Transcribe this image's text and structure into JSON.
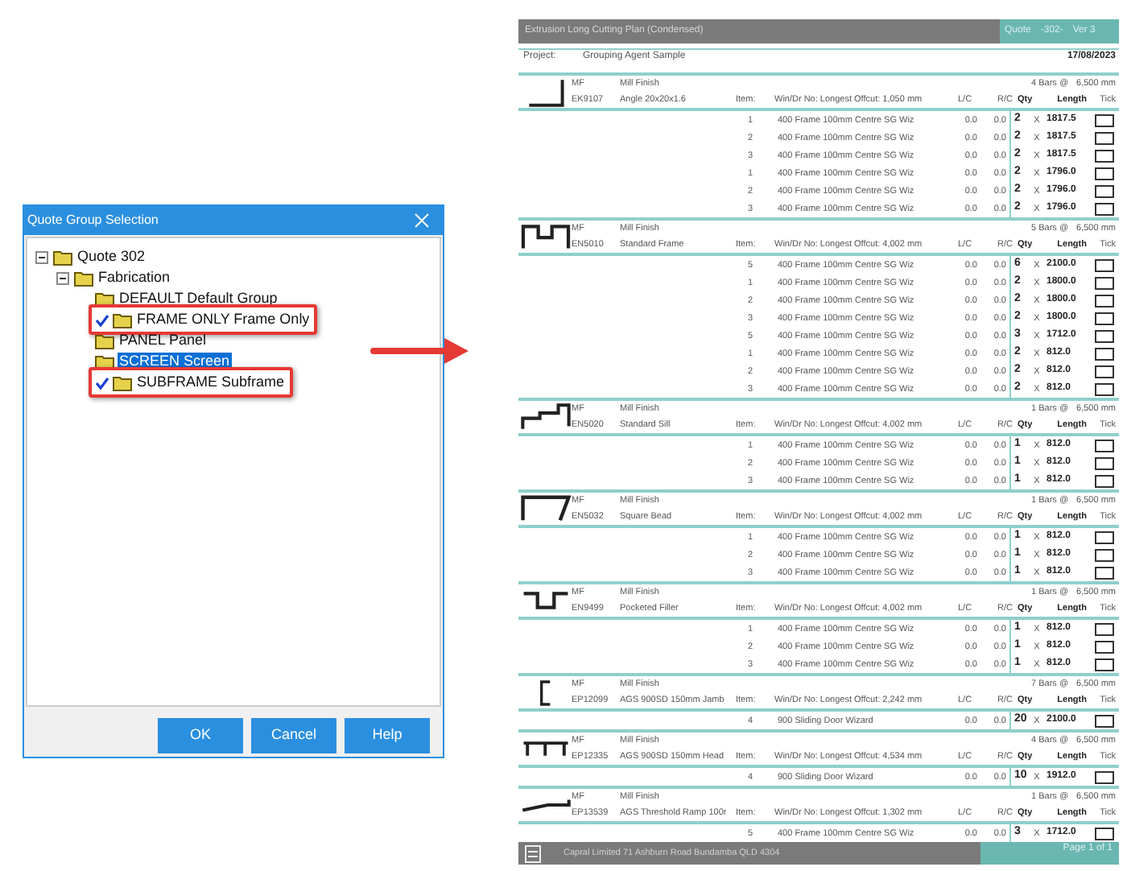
{
  "dialog": {
    "title": "Quote Group Selection",
    "tree": [
      {
        "label": "Quote  302",
        "expanded": true,
        "checked": false,
        "selected": false,
        "highlighted": false,
        "children": [
          {
            "label": "Fabrication",
            "expanded": true,
            "checked": false,
            "selected": false,
            "highlighted": false,
            "children": [
              {
                "label": "DEFAULT Default Group",
                "checked": false,
                "selected": false,
                "highlighted": false
              },
              {
                "label": "FRAME ONLY Frame Only",
                "checked": true,
                "selected": false,
                "highlighted": true
              },
              {
                "label": "PANEL Panel",
                "checked": false,
                "selected": false,
                "highlighted": false
              },
              {
                "label": "SCREEN Screen",
                "checked": false,
                "selected": true,
                "highlighted": false
              },
              {
                "label": "SUBFRAME Subframe",
                "checked": true,
                "selected": false,
                "highlighted": true
              }
            ]
          }
        ]
      }
    ],
    "buttons": [
      "OK",
      "Cancel",
      "Help"
    ]
  },
  "report": {
    "title": "Extrusion Long Cutting Plan (Condensed)",
    "quote_label": "Quote",
    "quote_number": "-302-",
    "version": "Ver 3",
    "project_label": "Project:",
    "project": "Grouping Agent Sample",
    "date": "17/08/2023",
    "sections": [
      {
        "kind": "angle",
        "finish_code": "MF",
        "finish": "Mill Finish",
        "code": "EK9107",
        "description": "Angle 20x20x1.6",
        "bars": "4 Bars @",
        "bar_length": "6,500 mm",
        "offcut": "Win/Dr No:  Longest Offcut: 1,050 mm",
        "labels": {
          "item": "Item:",
          "lc": "L/C",
          "rc": "R/C",
          "qty": "Qty",
          "length": "Length",
          "tick": "Tick"
        },
        "rows": [
          {
            "item": "1",
            "description": "400 Frame 100mm Centre SG Wiz",
            "lc": "0.0",
            "rc": "0.0",
            "qty": "2",
            "x": "X",
            "length": "1817.5",
            "ticked": false
          },
          {
            "item": "2",
            "description": "400 Frame 100mm Centre SG Wiz",
            "lc": "0.0",
            "rc": "0.0",
            "qty": "2",
            "x": "X",
            "length": "1817.5",
            "ticked": false
          },
          {
            "item": "3",
            "description": "400 Frame 100mm Centre SG Wiz",
            "lc": "0.0",
            "rc": "0.0",
            "qty": "2",
            "x": "X",
            "length": "1817.5",
            "ticked": false
          },
          {
            "item": "1",
            "description": "400 Frame 100mm Centre SG Wiz",
            "lc": "0.0",
            "rc": "0.0",
            "qty": "2",
            "x": "X",
            "length": "1796.0",
            "ticked": false
          },
          {
            "item": "2",
            "description": "400 Frame 100mm Centre SG Wiz",
            "lc": "0.0",
            "rc": "0.0",
            "qty": "2",
            "x": "X",
            "length": "1796.0",
            "ticked": false
          },
          {
            "item": "3",
            "description": "400 Frame 100mm Centre SG Wiz",
            "lc": "0.0",
            "rc": "0.0",
            "qty": "2",
            "x": "X",
            "length": "1796.0",
            "ticked": false
          }
        ]
      },
      {
        "kind": "frame",
        "finish_code": "MF",
        "finish": "Mill Finish",
        "code": "EN5010",
        "description": "Standard Frame",
        "bars": "5 Bars @",
        "bar_length": "6,500 mm",
        "offcut": "Win/Dr No:  Longest Offcut: 4,002 mm",
        "labels": {
          "item": "Item:",
          "lc": "L/C",
          "rc": "R/C",
          "qty": "Qty",
          "length": "Length",
          "tick": "Tick"
        },
        "rows": [
          {
            "item": "5",
            "description": "400 Frame 100mm Centre SG Wiz",
            "lc": "0.0",
            "rc": "0.0",
            "qty": "6",
            "x": "X",
            "length": "2100.0",
            "ticked": false
          },
          {
            "item": "1",
            "description": "400 Frame 100mm Centre SG Wiz",
            "lc": "0.0",
            "rc": "0.0",
            "qty": "2",
            "x": "X",
            "length": "1800.0",
            "ticked": false
          },
          {
            "item": "2",
            "description": "400 Frame 100mm Centre SG Wiz",
            "lc": "0.0",
            "rc": "0.0",
            "qty": "2",
            "x": "X",
            "length": "1800.0",
            "ticked": false
          },
          {
            "item": "3",
            "description": "400 Frame 100mm Centre SG Wiz",
            "lc": "0.0",
            "rc": "0.0",
            "qty": "2",
            "x": "X",
            "length": "1800.0",
            "ticked": false
          },
          {
            "item": "5",
            "description": "400 Frame 100mm Centre SG Wiz",
            "lc": "0.0",
            "rc": "0.0",
            "qty": "3",
            "x": "X",
            "length": "1712.0",
            "ticked": false
          },
          {
            "item": "1",
            "description": "400 Frame 100mm Centre SG Wiz",
            "lc": "0.0",
            "rc": "0.0",
            "qty": "2",
            "x": "X",
            "length": "812.0",
            "ticked": false
          },
          {
            "item": "2",
            "description": "400 Frame 100mm Centre SG Wiz",
            "lc": "0.0",
            "rc": "0.0",
            "qty": "2",
            "x": "X",
            "length": "812.0",
            "ticked": false
          },
          {
            "item": "3",
            "description": "400 Frame 100mm Centre SG Wiz",
            "lc": "0.0",
            "rc": "0.0",
            "qty": "2",
            "x": "X",
            "length": "812.0",
            "ticked": false
          }
        ]
      },
      {
        "kind": "sill",
        "finish_code": "MF",
        "finish": "Mill Finish",
        "code": "EN5020",
        "description": "Standard Sill",
        "bars": "1 Bars @",
        "bar_length": "6,500 mm",
        "offcut": "Win/Dr No:  Longest Offcut: 4,002 mm",
        "labels": {
          "item": "Item:",
          "lc": "L/C",
          "rc": "R/C",
          "qty": "Qty",
          "length": "Length",
          "tick": "Tick"
        },
        "rows": [
          {
            "item": "1",
            "description": "400 Frame 100mm Centre SG Wiz",
            "lc": "0.0",
            "rc": "0.0",
            "qty": "1",
            "x": "X",
            "length": "812.0",
            "ticked": false
          },
          {
            "item": "2",
            "description": "400 Frame 100mm Centre SG Wiz",
            "lc": "0.0",
            "rc": "0.0",
            "qty": "1",
            "x": "X",
            "length": "812.0",
            "ticked": false
          },
          {
            "item": "3",
            "description": "400 Frame 100mm Centre SG Wiz",
            "lc": "0.0",
            "rc": "0.0",
            "qty": "1",
            "x": "X",
            "length": "812.0",
            "ticked": false
          }
        ]
      },
      {
        "kind": "bead",
        "finish_code": "MF",
        "finish": "Mill Finish",
        "code": "EN5032",
        "description": "Square Bead",
        "bars": "1 Bars @",
        "bar_length": "6,500 mm",
        "offcut": "Win/Dr No:  Longest Offcut: 4,002 mm",
        "labels": {
          "item": "Item:",
          "lc": "L/C",
          "rc": "R/C",
          "qty": "Qty",
          "length": "Length",
          "tick": "Tick"
        },
        "rows": [
          {
            "item": "1",
            "description": "400 Frame 100mm Centre SG Wiz",
            "lc": "0.0",
            "rc": "0.0",
            "qty": "1",
            "x": "X",
            "length": "812.0",
            "ticked": false
          },
          {
            "item": "2",
            "description": "400 Frame 100mm Centre SG Wiz",
            "lc": "0.0",
            "rc": "0.0",
            "qty": "1",
            "x": "X",
            "length": "812.0",
            "ticked": false
          },
          {
            "item": "3",
            "description": "400 Frame 100mm Centre SG Wiz",
            "lc": "0.0",
            "rc": "0.0",
            "qty": "1",
            "x": "X",
            "length": "812.0",
            "ticked": false
          }
        ]
      },
      {
        "kind": "filler",
        "finish_code": "MF",
        "finish": "Mill Finish",
        "code": "EN9499",
        "description": "Pocketed Filler",
        "bars": "1 Bars @",
        "bar_length": "6,500 mm",
        "offcut": "Win/Dr No:  Longest Offcut: 4,002 mm",
        "labels": {
          "item": "Item:",
          "lc": "L/C",
          "rc": "R/C",
          "qty": "Qty",
          "length": "Length",
          "tick": "Tick"
        },
        "rows": [
          {
            "item": "1",
            "description": "400 Frame 100mm Centre SG Wiz",
            "lc": "0.0",
            "rc": "0.0",
            "qty": "1",
            "x": "X",
            "length": "812.0",
            "ticked": false
          },
          {
            "item": "2",
            "description": "400 Frame 100mm Centre SG Wiz",
            "lc": "0.0",
            "rc": "0.0",
            "qty": "1",
            "x": "X",
            "length": "812.0",
            "ticked": false
          },
          {
            "item": "3",
            "description": "400 Frame 100mm Centre SG Wiz",
            "lc": "0.0",
            "rc": "0.0",
            "qty": "1",
            "x": "X",
            "length": "812.0",
            "ticked": false
          }
        ]
      },
      {
        "kind": "jamb",
        "finish_code": "MF",
        "finish": "Mill Finish",
        "code": "EP12099",
        "description": "AGS 900SD 150mm Jamb",
        "bars": "7 Bars @",
        "bar_length": "6,500 mm",
        "offcut": "Win/Dr No:  Longest Offcut: 2,242 mm",
        "labels": {
          "item": "Item:",
          "lc": "L/C",
          "rc": "R/C",
          "qty": "Qty",
          "length": "Length",
          "tick": "Tick"
        },
        "rows": [
          {
            "item": "4",
            "description": "900 Sliding Door Wizard",
            "lc": "0.0",
            "rc": "0.0",
            "qty": "20",
            "x": "X",
            "length": "2100.0",
            "ticked": false
          }
        ]
      },
      {
        "kind": "head",
        "finish_code": "MF",
        "finish": "Mill Finish",
        "code": "EP12335",
        "description": "AGS 900SD 150mm Head",
        "bars": "4 Bars @",
        "bar_length": "6,500 mm",
        "offcut": "Win/Dr No:  Longest Offcut: 4,534 mm",
        "labels": {
          "item": "Item:",
          "lc": "L/C",
          "rc": "R/C",
          "qty": "Qty",
          "length": "Length",
          "tick": "Tick"
        },
        "rows": [
          {
            "item": "4",
            "description": "900 Sliding Door Wizard",
            "lc": "0.0",
            "rc": "0.0",
            "qty": "10",
            "x": "X",
            "length": "1912.0",
            "ticked": false
          }
        ]
      },
      {
        "kind": "ramp",
        "finish_code": "MF",
        "finish": "Mill Finish",
        "code": "EP13539",
        "description": "AGS Threshold Ramp 100r",
        "bars": "1 Bars @",
        "bar_length": "6,500 mm",
        "offcut": "Win/Dr No:  Longest Offcut: 1,302 mm",
        "labels": {
          "item": "Item:",
          "lc": "L/C",
          "rc": "R/C",
          "qty": "Qty",
          "length": "Length",
          "tick": "Tick"
        },
        "rows": [
          {
            "item": "5",
            "description": "400 Frame 100mm Centre SG Wiz",
            "lc": "0.0",
            "rc": "0.0",
            "qty": "3",
            "x": "X",
            "length": "1712.0",
            "ticked": false
          }
        ]
      }
    ],
    "footer": "Capral Limited 71 Ashburn Road Bundamba QLD 4304",
    "page": "Page 1 of 1"
  }
}
